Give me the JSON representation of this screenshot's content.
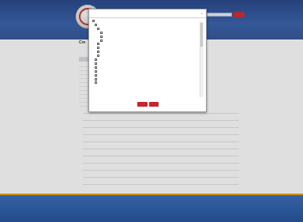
{
  "header": {
    "top_links": "",
    "search_placeholder": "",
    "search_button_label": ""
  },
  "page": {
    "title": "Cre",
    "breadcrumb": "",
    "right_link": ""
  },
  "list": {
    "items": [
      {
        "label": ""
      },
      {
        "label": ""
      },
      {
        "label": ""
      },
      {
        "label": ""
      },
      {
        "label": ""
      },
      {
        "label": ""
      },
      {
        "label": ""
      },
      {
        "label": ""
      },
      {
        "label": ""
      },
      {
        "label": ""
      },
      {
        "label": ""
      },
      {
        "label": ""
      }
    ]
  },
  "footer": {
    "text": ""
  },
  "modal": {
    "title": "",
    "close_symbol": "×",
    "tree": [
      {
        "label": "",
        "bold": true,
        "indent": 0
      },
      {
        "label": "",
        "bold": false,
        "indent": 1
      },
      {
        "label": "",
        "bold": true,
        "indent": 2
      },
      {
        "label": "",
        "bold": false,
        "indent": 3
      },
      {
        "label": "",
        "bold": false,
        "indent": 3
      },
      {
        "label": "",
        "bold": false,
        "indent": 3
      },
      {
        "label": "",
        "bold": true,
        "indent": 2
      },
      {
        "label": "",
        "bold": false,
        "indent": 2
      },
      {
        "label": "",
        "bold": true,
        "indent": 2
      },
      {
        "label": "",
        "bold": true,
        "indent": 2
      },
      {
        "label": "",
        "bold": false,
        "indent": 1
      },
      {
        "label": "",
        "bold": false,
        "indent": 1
      },
      {
        "label": "",
        "bold": false,
        "indent": 1
      },
      {
        "label": "",
        "bold": false,
        "indent": 1
      },
      {
        "label": "",
        "bold": false,
        "indent": 1
      },
      {
        "label": "",
        "bold": false,
        "indent": 1
      },
      {
        "label": "",
        "bold": false,
        "indent": 1
      }
    ],
    "primary_button": "",
    "secondary_button": ""
  },
  "colors": {
    "brand_blue": "#2f5aa8",
    "accent_red": "#c9242b",
    "footer_accent": "#f0a000"
  }
}
